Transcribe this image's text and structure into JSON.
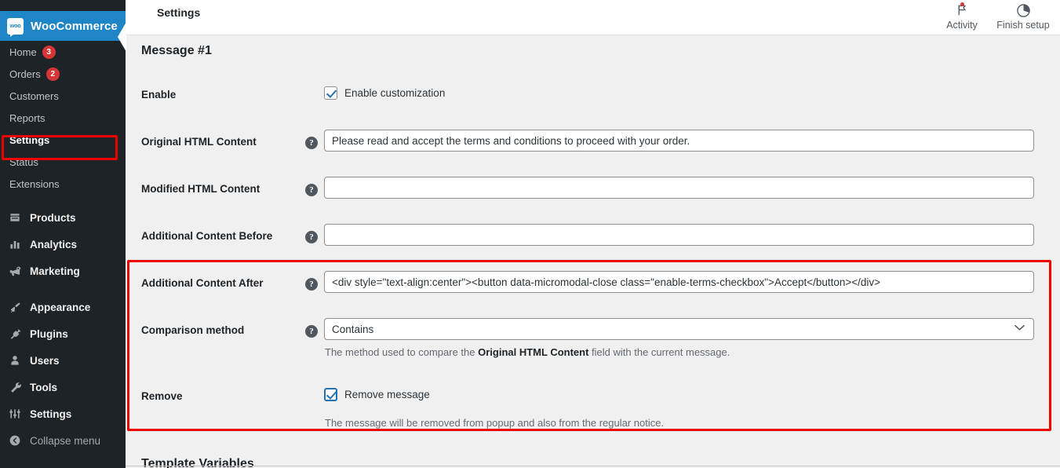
{
  "brand": {
    "name": "WooCommerce",
    "logo_text": "woo"
  },
  "sidebar": {
    "submenu": [
      {
        "label": "Home",
        "badge": "3",
        "current": false
      },
      {
        "label": "Orders",
        "badge": "2",
        "current": false
      },
      {
        "label": "Customers",
        "badge": "",
        "current": false
      },
      {
        "label": "Reports",
        "badge": "",
        "current": false
      },
      {
        "label": "Settings",
        "badge": "",
        "current": true
      },
      {
        "label": "Status",
        "badge": "",
        "current": false
      },
      {
        "label": "Extensions",
        "badge": "",
        "current": false
      }
    ],
    "main": [
      {
        "label": "Products",
        "icon": "products-icon",
        "dim": false
      },
      {
        "label": "Analytics",
        "icon": "analytics-icon",
        "dim": false
      },
      {
        "label": "Marketing",
        "icon": "marketing-megaphone-icon",
        "dim": false
      },
      {
        "label": "Appearance",
        "icon": "appearance-brush-icon",
        "dim": false
      },
      {
        "label": "Plugins",
        "icon": "plugins-plug-icon",
        "dim": false
      },
      {
        "label": "Users",
        "icon": "users-icon",
        "dim": false
      },
      {
        "label": "Tools",
        "icon": "tools-wrench-icon",
        "dim": false
      },
      {
        "label": "Settings",
        "icon": "settings-sliders-icon",
        "dim": false
      },
      {
        "label": "Collapse menu",
        "icon": "collapse-menu-icon",
        "dim": true
      }
    ],
    "highlight_color": "#ee0000"
  },
  "header": {
    "title": "Settings",
    "actions": [
      {
        "label": "Activity",
        "icon": "flag-icon",
        "has_dot": true
      },
      {
        "label": "Finish setup",
        "icon": "progress-circle-icon",
        "has_dot": false
      }
    ]
  },
  "main": {
    "section_title": "Message #1",
    "rows": {
      "enable": {
        "label": "Enable",
        "checkbox_label": "Enable customization",
        "checked": true,
        "focused": false
      },
      "original_html": {
        "label": "Original HTML Content",
        "value": "Please read and accept the terms and conditions to proceed with your order.",
        "help_icon": "question-mark-icon"
      },
      "modified_html": {
        "label": "Modified HTML Content",
        "value": "",
        "help_icon": "question-mark-icon"
      },
      "content_before": {
        "label": "Additional Content Before",
        "value": "",
        "help_icon": "question-mark-icon"
      },
      "content_after": {
        "label": "Additional Content After",
        "value": "<div style=\"text-align:center\"><button data-micromodal-close class=\"enable-terms-checkbox\">Accept</button></div>",
        "help_icon": "question-mark-icon"
      },
      "comparison_method": {
        "label": "Comparison method",
        "value": "Contains",
        "help_icon": "question-mark-icon",
        "chevron": "∨",
        "help_text_before": "The method used to compare the ",
        "help_text_bold": "Original HTML Content",
        "help_text_after": " field with the current message."
      },
      "remove": {
        "label": "Remove",
        "checkbox_label": "Remove message",
        "checked": true,
        "focused": true,
        "help_text": "The message will be removed from popup and also from the regular notice."
      }
    },
    "next_section_title": "Template Variables",
    "callout_color": "#ee0000"
  }
}
